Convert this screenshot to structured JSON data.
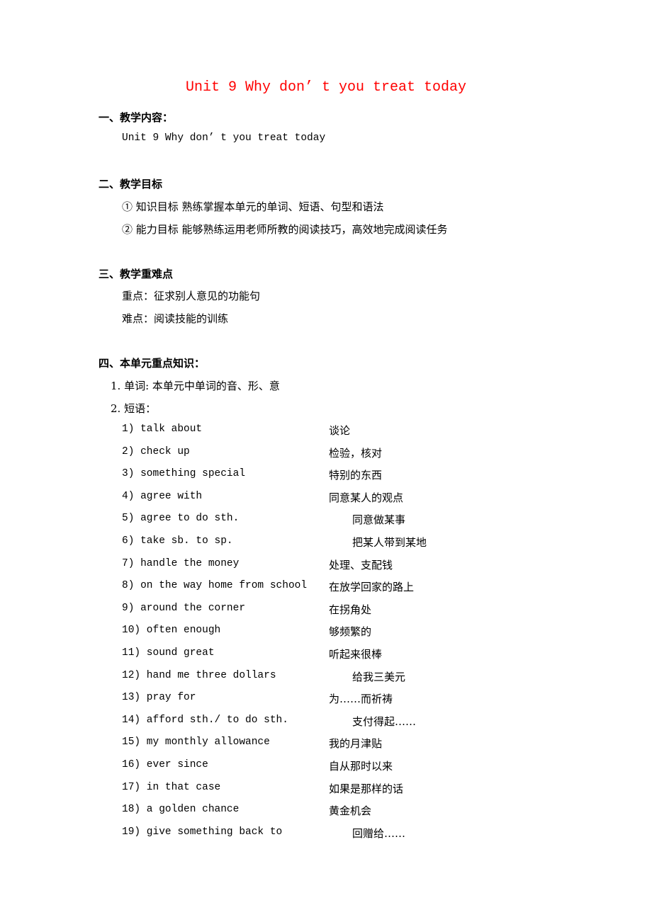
{
  "title": "Unit 9 Why don’ t you treat today",
  "title_color": "#ff0000",
  "sections": {
    "content": {
      "heading": "一、教学内容：",
      "text": "Unit 9 Why don’ t you treat today"
    },
    "goals": {
      "heading": "二、教学目标",
      "items": [
        "① 知识目标 熟练掌握本单元的单词、短语、句型和语法",
        "② 能力目标 能够熟练运用老师所教的阅读技巧，高效地完成阅读任务"
      ]
    },
    "key_points": {
      "heading": "三、教学重难点",
      "items": [
        "重点：征求别人意见的功能句",
        "难点：阅读技能的训练"
      ]
    },
    "knowledge": {
      "heading": "四、本单元重点知识：",
      "items": [
        "1. 单词: 本单元中单词的音、形、意",
        "2. 短语："
      ],
      "phrases": [
        {
          "en": "1) talk about",
          "zh": "谈论",
          "indent": false
        },
        {
          "en": "2) check up",
          "zh": "检验，核对",
          "indent": false
        },
        {
          "en": "3) something special",
          "zh": "特别的东西",
          "indent": false
        },
        {
          "en": "4) agree with",
          "zh": "同意某人的观点",
          "indent": false
        },
        {
          "en": "5) agree to do sth.",
          "zh": "同意做某事",
          "indent": true
        },
        {
          "en": "6) take sb. to sp.",
          "zh": "把某人带到某地",
          "indent": true
        },
        {
          "en": "7) handle the money",
          "zh": "处理、支配钱",
          "indent": false
        },
        {
          "en": "8) on the way home from school",
          "zh": "在放学回家的路上",
          "indent": false
        },
        {
          "en": "9) around the corner",
          "zh": "在拐角处",
          "indent": false
        },
        {
          "en": "10) often enough",
          "zh": "够频繁的",
          "indent": false
        },
        {
          "en": "11) sound great",
          "zh": "听起来很棒",
          "indent": false
        },
        {
          "en": "12) hand me three dollars",
          "zh": "给我三美元",
          "indent": true
        },
        {
          "en": "13) pray for",
          "zh": "为……而祈祷",
          "indent": false
        },
        {
          "en": "14) afford sth./ to do sth.",
          "zh": "支付得起……",
          "indent": true
        },
        {
          "en": "15) my monthly allowance",
          "zh": "我的月津贴",
          "indent": false
        },
        {
          "en": "16) ever since",
          "zh": "自从那时以来",
          "indent": false
        },
        {
          "en": "17) in that case",
          "zh": "如果是那样的话",
          "indent": false
        },
        {
          "en": "18) a golden chance",
          "zh": "黄金机会",
          "indent": false
        },
        {
          "en": "19) give something back to",
          "zh": "回赠给……",
          "indent": true
        }
      ]
    }
  }
}
